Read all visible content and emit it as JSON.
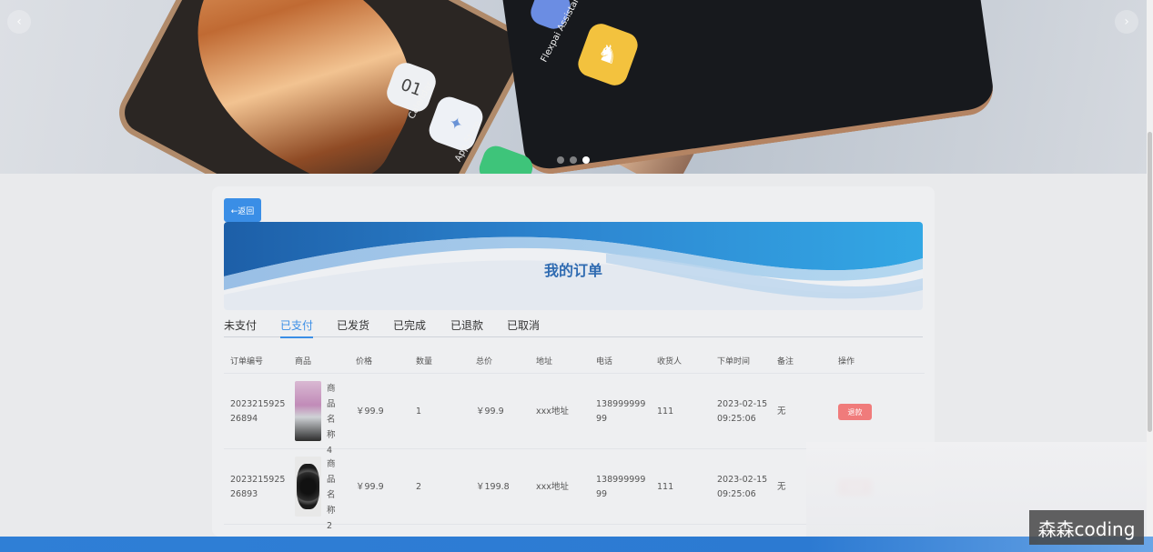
{
  "banner": {
    "apps": {
      "calendar_label": "Calendar",
      "calendar_day": "01",
      "appstore_label": "App Store",
      "assistant_label": "Flexpai Assistant"
    },
    "prev_icon": "chevron-left-icon",
    "next_icon": "chevron-right-icon",
    "slide_count": 3,
    "active_slide": 3
  },
  "card": {
    "back_label": "←返回",
    "title": "我的订单",
    "tabs": [
      {
        "label": "未支付"
      },
      {
        "label": "已支付",
        "active": true
      },
      {
        "label": "已发货"
      },
      {
        "label": "已完成"
      },
      {
        "label": "已退款"
      },
      {
        "label": "已取消"
      }
    ],
    "columns": [
      "订单编号",
      "商品",
      "价格",
      "数量",
      "总价",
      "地址",
      "电话",
      "收货人",
      "下单时间",
      "备注",
      "操作"
    ],
    "rows": [
      {
        "order_no_line1": "2023215925",
        "order_no_line2": "26894",
        "product_name": "商品名称4",
        "price": "￥99.9",
        "qty": "1",
        "total": "￥99.9",
        "address": "xxx地址",
        "phone_line1": "138999999",
        "phone_line2": "99",
        "receiver": "111",
        "time_line1": "2023-02-15",
        "time_line2": "09:25:06",
        "remark": "无",
        "action": "退款"
      },
      {
        "order_no_line1": "2023215925",
        "order_no_line2": "26893",
        "product_name": "商品名称2",
        "price": "￥99.9",
        "qty": "2",
        "total": "￥199.8",
        "address": "xxx地址",
        "phone_line1": "138999999",
        "phone_line2": "99",
        "receiver": "111",
        "time_line1": "2023-02-15",
        "time_line2": "09:25:06",
        "remark": "无",
        "action": "退款"
      }
    ]
  },
  "watermark": "森森coding",
  "colors": {
    "primary": "#3a8ee6",
    "danger": "#f07b7b",
    "title": "#2f6bb1"
  }
}
